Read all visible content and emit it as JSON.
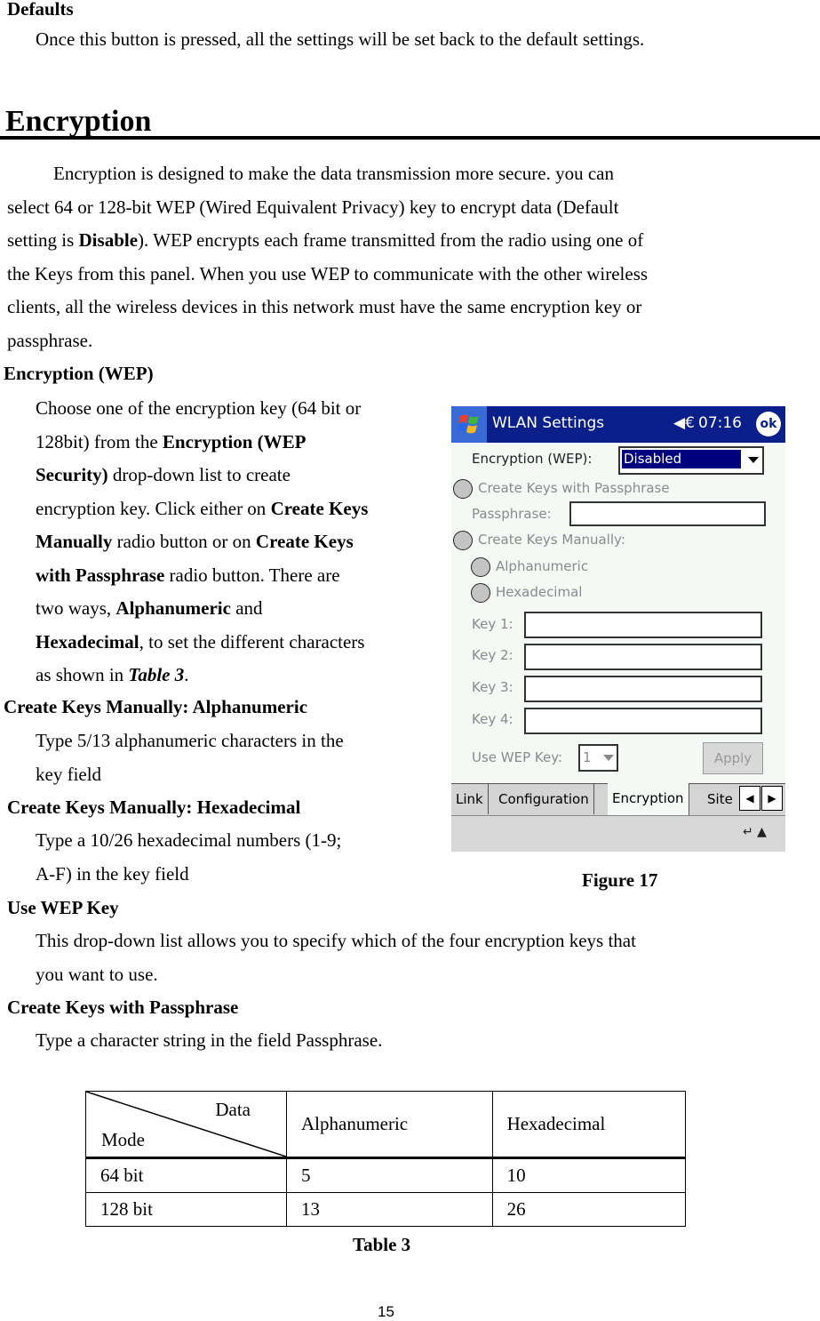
{
  "defaults": {
    "heading": "Defaults",
    "text": "Once this button is pressed, all the settings will be set back to the default settings."
  },
  "encryption": {
    "heading": "Encryption",
    "intro_lines": [
      "Encryption is designed to make the data transmission more secure. you can",
      "select 64 or 128-bit WEP (Wired Equivalent Privacy) key to encrypt data (Default",
      "setting is ",
      "Disable",
      "). WEP encrypts each frame transmitted from the radio using one of",
      "the Keys from this panel. When you use WEP to communicate with the other wireless",
      "clients, all the wireless devices in this network must have the same encryption key or",
      "passphrase."
    ]
  },
  "sections": {
    "wep": {
      "heading": "Encryption (WEP)",
      "l1": "Choose one of the encryption key (64 bit or",
      "l2a": "128bit) from the ",
      "l2b": "Encryption (WEP",
      "l3a": "Security)",
      "l3b": " drop-down list to create",
      "l4a": "encryption key. Click either on ",
      "l4b": "Create Keys",
      "l5a": "Manually",
      "l5b": " radio button or on ",
      "l5c": "Create Keys",
      "l6a": "with Passphrase",
      "l6b": " radio button. There are",
      "l7a": "two ways, ",
      "l7b": "Alphanumeric",
      "l7c": " and",
      "l8a": "Hexadecimal",
      "l8b": ", to set the different characters",
      "l9a": "as shown in ",
      "l9b": "Table 3",
      "l9c": "."
    },
    "alpha": {
      "heading": "Create Keys Manually: Alphanumeric",
      "l1": "Type 5/13 alphanumeric characters in the",
      "l2": "key field"
    },
    "hex": {
      "heading": "Create Keys Manually: Hexadecimal",
      "l1": "Type a 10/26 hexadecimal numbers (1-9;",
      "l2": "A-F) in the key field"
    },
    "usekey": {
      "heading": "Use WEP Key",
      "l1": "This drop-down list allows you to specify which of the four encryption keys that",
      "l2": "you want to use."
    },
    "passphrase": {
      "heading": "Create Keys with Passphrase",
      "l1": "Type a character string in the field Passphrase."
    }
  },
  "figure": {
    "caption": "Figure 17",
    "window_title": "WLAN Settings",
    "clock": "07:16",
    "ok_label": "ok",
    "speaker_glyph": "◀€",
    "encryption_label": "Encryption (WEP):",
    "encryption_value": "Disabled",
    "radio_passphrase": "Create Keys with Passphrase",
    "passphrase_label": "Passphrase:",
    "radio_manual": "Create Keys Manually:",
    "radio_alpha": "Alphanumeric",
    "radio_hex": "Hexadecimal",
    "keys": [
      {
        "label": "Key 1:"
      },
      {
        "label": "Key 2:"
      },
      {
        "label": "Key 3:"
      },
      {
        "label": "Key 4:"
      }
    ],
    "use_wep_label": "Use WEP Key:",
    "use_wep_value": "1",
    "apply_label": "Apply",
    "tabs": [
      "Link",
      "Configuration",
      "Encryption",
      "Site"
    ],
    "active_tab": "Encryption",
    "scroll_left": "◀",
    "scroll_right": "▶",
    "menubar_glyph": "↵ ▲"
  },
  "table": {
    "caption": "Table 3",
    "corner_top": "Data",
    "corner_bottom": "Mode",
    "columns": [
      "Alphanumeric",
      "Hexadecimal"
    ],
    "rows": [
      {
        "mode": "64 bit",
        "alphanumeric": "5",
        "hexadecimal": "10"
      },
      {
        "mode": "128 bit",
        "alphanumeric": "13",
        "hexadecimal": "26"
      }
    ]
  },
  "page_number": "15"
}
